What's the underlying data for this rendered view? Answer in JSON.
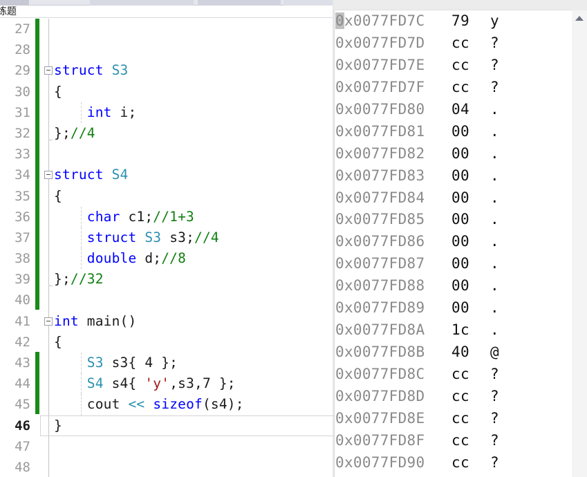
{
  "window": {
    "breadcrumb": "练题"
  },
  "editor": {
    "first_line": 27,
    "current_line": 46,
    "lines": [
      {
        "n": "27",
        "tokens": []
      },
      {
        "n": "28",
        "tokens": []
      },
      {
        "n": "29",
        "fold": "open",
        "tokens": [
          {
            "t": "struct ",
            "c": "kw"
          },
          {
            "t": "S3",
            "c": "typ"
          }
        ]
      },
      {
        "n": "30",
        "guide": false,
        "tokens": [
          {
            "t": "{",
            "c": "pl"
          }
        ]
      },
      {
        "n": "31",
        "guide": true,
        "tokens": [
          {
            "t": "    ",
            "c": "pl"
          },
          {
            "t": "int",
            "c": "kw"
          },
          {
            "t": " i;",
            "c": "pl"
          }
        ]
      },
      {
        "n": "32",
        "foldend": true,
        "tokens": [
          {
            "t": "};",
            "c": "pl"
          },
          {
            "t": "//4",
            "c": "cmt"
          }
        ]
      },
      {
        "n": "33",
        "tokens": []
      },
      {
        "n": "34",
        "fold": "open",
        "tokens": [
          {
            "t": "struct ",
            "c": "kw"
          },
          {
            "t": "S4",
            "c": "typ"
          }
        ]
      },
      {
        "n": "35",
        "tokens": [
          {
            "t": "{",
            "c": "pl"
          }
        ]
      },
      {
        "n": "36",
        "guide": true,
        "tokens": [
          {
            "t": "    ",
            "c": "pl"
          },
          {
            "t": "char",
            "c": "kw"
          },
          {
            "t": " c1;",
            "c": "pl"
          },
          {
            "t": "//1+3",
            "c": "cmt"
          }
        ]
      },
      {
        "n": "37",
        "guide": true,
        "tokens": [
          {
            "t": "    ",
            "c": "pl"
          },
          {
            "t": "struct",
            "c": "kw"
          },
          {
            "t": " ",
            "c": "pl"
          },
          {
            "t": "S3",
            "c": "typ"
          },
          {
            "t": " s3;",
            "c": "pl"
          },
          {
            "t": "//4",
            "c": "cmt"
          }
        ]
      },
      {
        "n": "38",
        "guide": true,
        "tokens": [
          {
            "t": "    ",
            "c": "pl"
          },
          {
            "t": "double",
            "c": "kw"
          },
          {
            "t": " d;",
            "c": "pl"
          },
          {
            "t": "//8",
            "c": "cmt"
          }
        ]
      },
      {
        "n": "39",
        "foldend": true,
        "tokens": [
          {
            "t": "};",
            "c": "pl"
          },
          {
            "t": "//32",
            "c": "cmt"
          }
        ]
      },
      {
        "n": "40",
        "tokens": []
      },
      {
        "n": "41",
        "fold": "open",
        "tokens": [
          {
            "t": "int",
            "c": "kw"
          },
          {
            "t": " main()",
            "c": "fn"
          }
        ]
      },
      {
        "n": "42",
        "tokens": [
          {
            "t": "{",
            "c": "pl"
          }
        ]
      },
      {
        "n": "43",
        "guide": true,
        "tokens": [
          {
            "t": "    ",
            "c": "pl"
          },
          {
            "t": "S3",
            "c": "typ"
          },
          {
            "t": " s3{ 4 };",
            "c": "pl"
          }
        ]
      },
      {
        "n": "44",
        "guide": true,
        "tokens": [
          {
            "t": "    ",
            "c": "pl"
          },
          {
            "t": "S4",
            "c": "typ"
          },
          {
            "t": " s4{ ",
            "c": "pl"
          },
          {
            "t": "'y'",
            "c": "str"
          },
          {
            "t": ",s3,7 };",
            "c": "pl"
          }
        ]
      },
      {
        "n": "45",
        "guide": true,
        "tokens": [
          {
            "t": "    cout ",
            "c": "pl"
          },
          {
            "t": "<<",
            "c": "opg"
          },
          {
            "t": " ",
            "c": "pl"
          },
          {
            "t": "sizeof",
            "c": "kw"
          },
          {
            "t": "(s4);",
            "c": "pl"
          }
        ]
      },
      {
        "n": "46",
        "current": true,
        "tokens": [
          {
            "t": "}",
            "c": "pl"
          }
        ]
      },
      {
        "n": "47",
        "tokens": []
      },
      {
        "n": "48",
        "tokens": []
      }
    ]
  },
  "memory": {
    "columns": [
      "address",
      "value",
      "ascii"
    ],
    "cursor_row": 0,
    "rows": [
      {
        "addr": "0x0077FD7C",
        "hex": "79",
        "ascii": "y"
      },
      {
        "addr": "0x0077FD7D",
        "hex": "cc",
        "ascii": "?"
      },
      {
        "addr": "0x0077FD7E",
        "hex": "cc",
        "ascii": "?"
      },
      {
        "addr": "0x0077FD7F",
        "hex": "cc",
        "ascii": "?"
      },
      {
        "addr": "0x0077FD80",
        "hex": "04",
        "ascii": "."
      },
      {
        "addr": "0x0077FD81",
        "hex": "00",
        "ascii": "."
      },
      {
        "addr": "0x0077FD82",
        "hex": "00",
        "ascii": "."
      },
      {
        "addr": "0x0077FD83",
        "hex": "00",
        "ascii": "."
      },
      {
        "addr": "0x0077FD84",
        "hex": "00",
        "ascii": "."
      },
      {
        "addr": "0x0077FD85",
        "hex": "00",
        "ascii": "."
      },
      {
        "addr": "0x0077FD86",
        "hex": "00",
        "ascii": "."
      },
      {
        "addr": "0x0077FD87",
        "hex": "00",
        "ascii": "."
      },
      {
        "addr": "0x0077FD88",
        "hex": "00",
        "ascii": "."
      },
      {
        "addr": "0x0077FD89",
        "hex": "00",
        "ascii": "."
      },
      {
        "addr": "0x0077FD8A",
        "hex": "1c",
        "ascii": "."
      },
      {
        "addr": "0x0077FD8B",
        "hex": "40",
        "ascii": "@"
      },
      {
        "addr": "0x0077FD8C",
        "hex": "cc",
        "ascii": "?"
      },
      {
        "addr": "0x0077FD8D",
        "hex": "cc",
        "ascii": "?"
      },
      {
        "addr": "0x0077FD8E",
        "hex": "cc",
        "ascii": "?"
      },
      {
        "addr": "0x0077FD8F",
        "hex": "cc",
        "ascii": "?"
      },
      {
        "addr": "0x0077FD90",
        "hex": "cc",
        "ascii": "?"
      }
    ]
  },
  "scrollbar": {
    "up_arrow": "scroll-up-arrow"
  },
  "colors": {
    "keyword": "#0000ff",
    "type": "#2b91af",
    "comment": "#108010",
    "string": "#a31515",
    "changebar": "#1a8a1a",
    "linenumber": "#9a9a9a",
    "mem_address": "#8a8a8a",
    "mem_value": "#111111"
  }
}
